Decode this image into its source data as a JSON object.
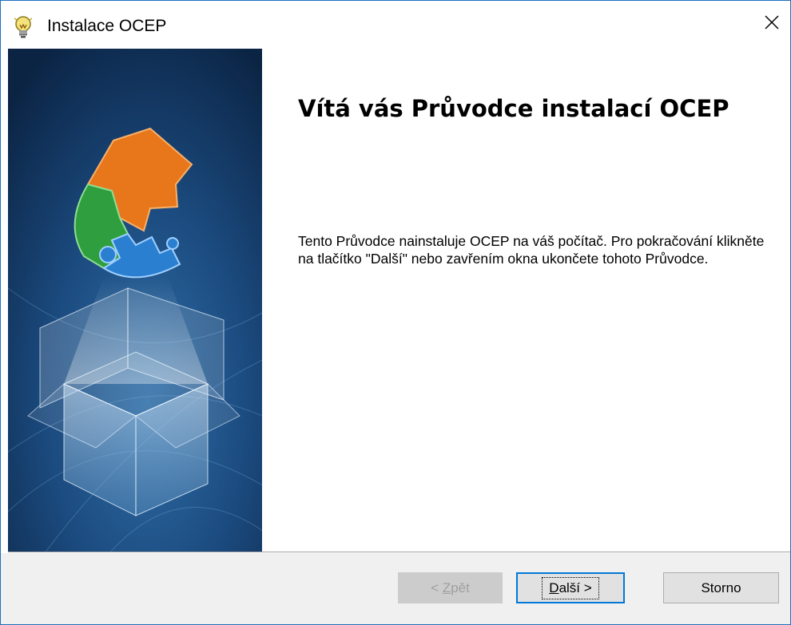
{
  "window": {
    "title": "Instalace OCEP",
    "icon": "lightbulb-icon",
    "close_icon": "close-icon"
  },
  "content": {
    "heading": "Vítá vás Průvodce instalací OCEP",
    "description": "Tento Průvodce nainstaluje OCEP na váš počítač. Pro pokračování klikněte na tlačítko \"Další\" nebo zavřením okna ukončete tohoto Průvodce."
  },
  "buttons": {
    "back_prefix": "< ",
    "back_accel": "Z",
    "back_rest": "pět",
    "next_accel": "D",
    "next_rest": "alší >",
    "cancel": "Storno"
  },
  "colors": {
    "banner_dark": "#0d2a4f",
    "banner_light": "#2f6fa8",
    "puzzle_orange": "#e8761a",
    "puzzle_green": "#2e9e3f",
    "puzzle_blue": "#2a7fd0",
    "accent": "#0078d7"
  }
}
